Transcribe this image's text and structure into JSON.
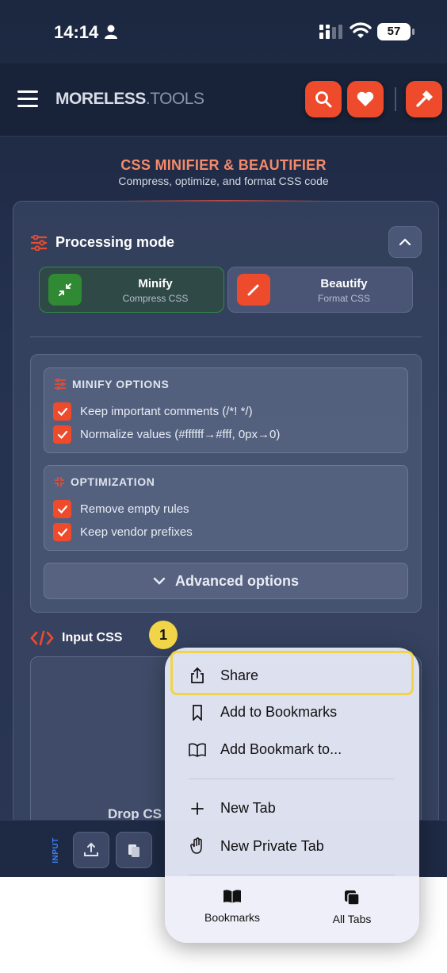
{
  "status_bar": {
    "time": "14:14",
    "battery": "57"
  },
  "header": {
    "logo_a": "MORELESS",
    "logo_b": ".TOOLS"
  },
  "page": {
    "title": "CSS MINIFIER & BEAUTIFIER",
    "subtitle": "Compress, optimize, and format CSS code"
  },
  "processing": {
    "title": "Processing mode",
    "modes": [
      {
        "label": "Minify",
        "sub": "Compress CSS",
        "selected": true
      },
      {
        "label": "Beautify",
        "sub": "Format CSS",
        "selected": false
      }
    ]
  },
  "minify_options": {
    "title": "MINIFY OPTIONS",
    "items": [
      {
        "label": "Keep important comments (/*! */)",
        "checked": true
      },
      {
        "label": "Normalize values (#ffffff→#fff, 0px→0)",
        "checked": true
      }
    ]
  },
  "optimization": {
    "title": "OPTIMIZATION",
    "items": [
      {
        "label": "Remove empty rules",
        "checked": true
      },
      {
        "label": "Keep vendor prefixes",
        "checked": true
      }
    ]
  },
  "advanced": {
    "label": "Advanced options"
  },
  "input": {
    "title": "Input CSS",
    "drop_text": "Drop CS",
    "tag": "INPUT"
  },
  "context_menu": {
    "items": [
      {
        "label": "Share",
        "icon": "share-icon"
      },
      {
        "label": "Add to Bookmarks",
        "icon": "bookmark-icon"
      },
      {
        "label": "Add Bookmark to...",
        "icon": "book-icon"
      },
      {
        "label": "New Tab",
        "icon": "plus-icon"
      },
      {
        "label": "New Private Tab",
        "icon": "hand-icon"
      }
    ],
    "footer": [
      {
        "label": "Bookmarks",
        "icon": "bookmarks-icon"
      },
      {
        "label": "All Tabs",
        "icon": "tabs-icon"
      }
    ]
  },
  "annotation": {
    "step": "1"
  },
  "colors": {
    "accent": "#ee4a2c",
    "minify_green": "#2f8a33",
    "highlight": "#f1d447"
  }
}
